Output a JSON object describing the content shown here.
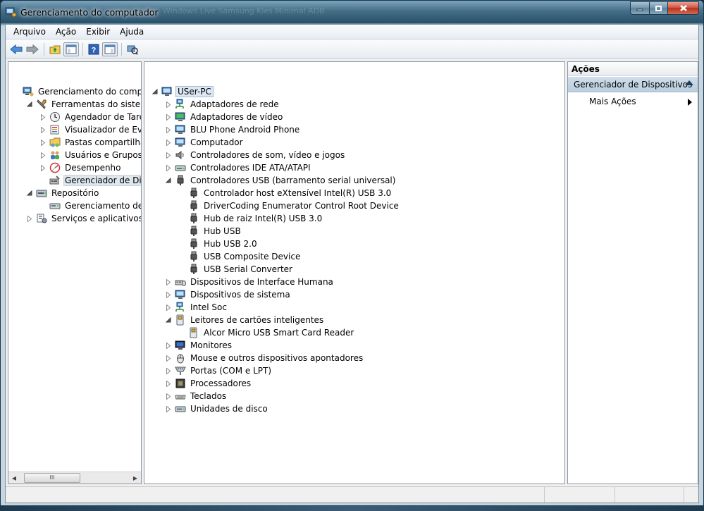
{
  "window": {
    "title": "Gerenciamento do computador",
    "ghost_tabs": "Windows Live     Samsung Kies     Minimal ADB"
  },
  "menubar": {
    "items": [
      "Arquivo",
      "Ação",
      "Exibir",
      "Ajuda"
    ]
  },
  "left_tree": [
    {
      "label": "Gerenciamento do computado",
      "icon": "computer-management-icon",
      "expander": "none",
      "level": 0
    },
    {
      "label": "Ferramentas do sistema",
      "icon": "tools-icon",
      "expander": "expanded",
      "level": 1
    },
    {
      "label": "Agendador de Tarefas",
      "icon": "clock-icon",
      "expander": "collapsed",
      "level": 2
    },
    {
      "label": "Visualizador de Eventos",
      "icon": "event-viewer-icon",
      "expander": "collapsed",
      "level": 2
    },
    {
      "label": "Pastas compartilhadas",
      "icon": "shared-folder-icon",
      "expander": "collapsed",
      "level": 2
    },
    {
      "label": "Usuários e Grupos Loca",
      "icon": "users-icon",
      "expander": "collapsed",
      "level": 2
    },
    {
      "label": "Desempenho",
      "icon": "performance-icon",
      "expander": "collapsed",
      "level": 2
    },
    {
      "label": "Gerenciador de Disposit",
      "icon": "device-manager-icon",
      "expander": "none",
      "level": 2,
      "selected": true
    },
    {
      "label": "Repositório",
      "icon": "storage-icon",
      "expander": "expanded",
      "level": 1
    },
    {
      "label": "Gerenciamento de disco",
      "icon": "disk-management-icon",
      "expander": "none",
      "level": 2
    },
    {
      "label": "Serviços e aplicativos",
      "icon": "services-icon",
      "expander": "collapsed",
      "level": 1
    }
  ],
  "device_tree": [
    {
      "label": "USer-PC",
      "icon": "computer-icon",
      "expander": "expanded",
      "level": 0,
      "root": true
    },
    {
      "label": "Adaptadores de rede",
      "icon": "network-adapter-icon",
      "expander": "collapsed",
      "level": 1
    },
    {
      "label": "Adaptadores de vídeo",
      "icon": "display-adapter-icon",
      "expander": "collapsed",
      "level": 1
    },
    {
      "label": "BLU Phone Android Phone",
      "icon": "phone-icon",
      "expander": "collapsed",
      "level": 1
    },
    {
      "label": "Computador",
      "icon": "computer-icon",
      "expander": "collapsed",
      "level": 1
    },
    {
      "label": "Controladores de som, vídeo e jogos",
      "icon": "speaker-icon",
      "expander": "collapsed",
      "level": 1
    },
    {
      "label": "Controladores IDE ATA/ATAPI",
      "icon": "ide-controller-icon",
      "expander": "collapsed",
      "level": 1
    },
    {
      "label": "Controladores USB (barramento serial universal)",
      "icon": "usb-icon",
      "expander": "expanded",
      "level": 1
    },
    {
      "label": "Controlador host eXtensível Intel(R) USB 3.0",
      "icon": "usb-icon",
      "expander": "none",
      "level": 2
    },
    {
      "label": "DriverCoding Enumerator Control Root Device",
      "icon": "usb-icon",
      "expander": "none",
      "level": 2
    },
    {
      "label": "Hub de raiz Intel(R) USB 3.0",
      "icon": "usb-icon",
      "expander": "none",
      "level": 2
    },
    {
      "label": "Hub USB",
      "icon": "usb-icon",
      "expander": "none",
      "level": 2
    },
    {
      "label": "Hub USB 2.0",
      "icon": "usb-icon",
      "expander": "none",
      "level": 2
    },
    {
      "label": "USB Composite Device",
      "icon": "usb-icon",
      "expander": "none",
      "level": 2
    },
    {
      "label": "USB Serial Converter",
      "icon": "usb-icon",
      "expander": "none",
      "level": 2
    },
    {
      "label": "Dispositivos de Interface Humana",
      "icon": "hid-icon",
      "expander": "collapsed",
      "level": 1
    },
    {
      "label": "Dispositivos de sistema",
      "icon": "system-device-icon",
      "expander": "collapsed",
      "level": 1
    },
    {
      "label": "Intel Soc",
      "icon": "network-adapter-icon",
      "expander": "collapsed",
      "level": 1
    },
    {
      "label": "Leitores de cartões inteligentes",
      "icon": "smart-card-icon",
      "expander": "expanded",
      "level": 1
    },
    {
      "label": "Alcor Micro USB Smart Card Reader",
      "icon": "smart-card-icon",
      "expander": "none",
      "level": 2
    },
    {
      "label": "Monitores",
      "icon": "monitor-icon",
      "expander": "collapsed",
      "level": 1
    },
    {
      "label": "Mouse e outros dispositivos apontadores",
      "icon": "mouse-icon",
      "expander": "collapsed",
      "level": 1
    },
    {
      "label": "Portas (COM e LPT)",
      "icon": "port-icon",
      "expander": "collapsed",
      "level": 1
    },
    {
      "label": "Processadores",
      "icon": "processor-icon",
      "expander": "collapsed",
      "level": 1
    },
    {
      "label": "Teclados",
      "icon": "keyboard-icon",
      "expander": "collapsed",
      "level": 1
    },
    {
      "label": "Unidades de disco",
      "icon": "disk-drive-icon",
      "expander": "collapsed",
      "level": 1
    }
  ],
  "actions": {
    "header": "Ações",
    "section": "Gerenciador de Dispositivos",
    "item": "Mais Ações"
  },
  "scrollbar": {
    "thumb_glyph": "III"
  },
  "colors": {
    "selection": "#dfe7ee",
    "actions_section": "#c3d5e4",
    "title_bar": "#2b5670"
  }
}
